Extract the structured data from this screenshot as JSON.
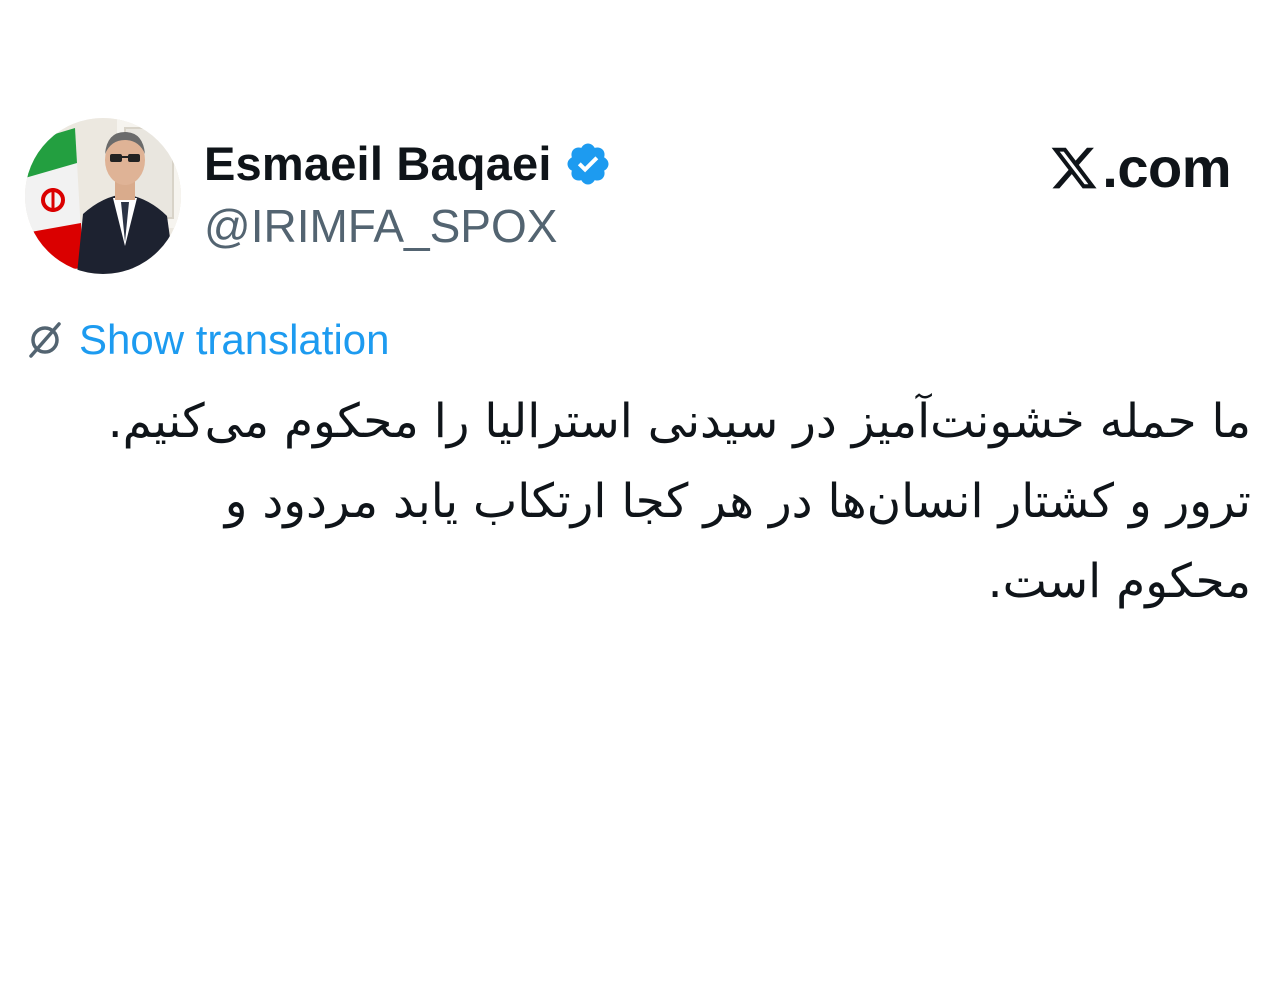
{
  "tweet": {
    "author": {
      "display_name": "Esmaeil Baqaei",
      "handle": "@IRIMFA_SPOX",
      "verified": true,
      "avatar_icon": "profile-photo-with-iran-flag"
    },
    "site": {
      "logo_icon": "x-logo-icon",
      "domain": ".com"
    },
    "translate": {
      "icon": "globe-icon",
      "label": "Show translation"
    },
    "text": "ما حمله خشونت‌آمیز در سیدنی استرالیا را محکوم می‌کنیم. ترور و کشتار انسان‌ها در هر کجا ارتکاب یابد مردود و محکوم است."
  },
  "colors": {
    "link": "#1d9bf0",
    "verified": "#1d9bf0",
    "handle": "#536471",
    "text": "#0f1419",
    "background": "#ffffff"
  }
}
